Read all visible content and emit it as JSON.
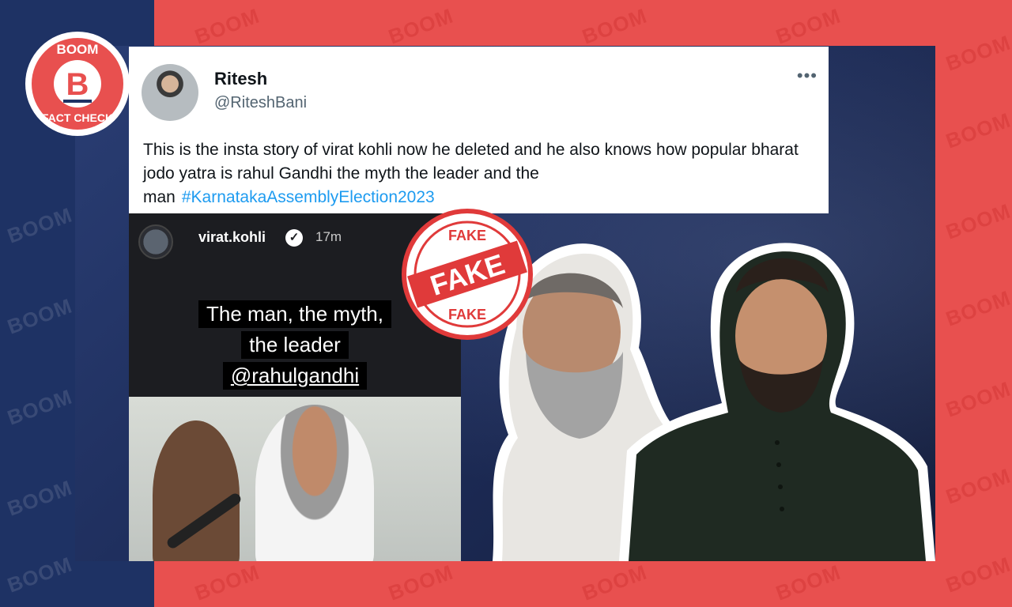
{
  "brand": {
    "logo_top": "BOOM",
    "logo_letter": "B",
    "logo_bottom": "FACT CHECK",
    "watermark": "BOOM"
  },
  "tweet": {
    "name": "Ritesh",
    "handle": "@RiteshBani",
    "more": "•••",
    "text": "This is the insta story of virat kohli now he deleted and he also knows how popular bharat jodo yatra is rahul Gandhi the myth the leader and the man",
    "hashtag": "#KarnatakaAssemblyElection2023"
  },
  "story": {
    "username": "virat.kohli",
    "verified": "✓",
    "time": "17m",
    "caption_line1": "The man, the myth,",
    "caption_line2": "the leader",
    "caption_line3": "@rahulgandhi"
  },
  "stamp": {
    "main": "FAKE",
    "top": "FAKE",
    "bottom": "FAKE"
  },
  "colors": {
    "brand_red": "#e8504f",
    "navy": "#1e3264",
    "link_blue": "#1d9bf0"
  }
}
